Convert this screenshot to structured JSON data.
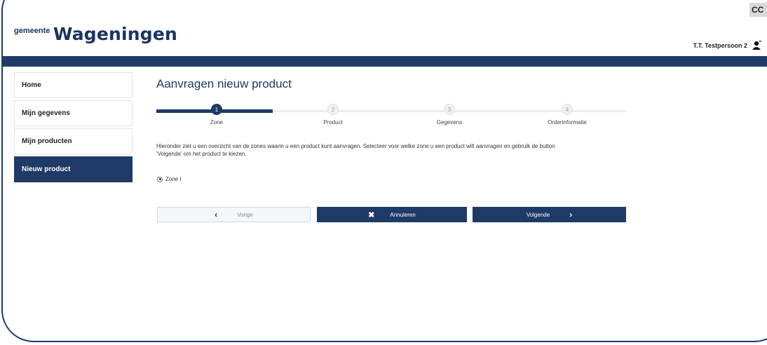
{
  "header": {
    "logo_prefix": "gemeente",
    "logo_name": "Wageningen",
    "user_name": "T.T. Testpersoon 2",
    "corner_label": "CC"
  },
  "sidebar": {
    "items": [
      {
        "label": "Home"
      },
      {
        "label": "Mijn gegevens"
      },
      {
        "label": "Mijn producten"
      },
      {
        "label": "Nieuw product"
      }
    ]
  },
  "main": {
    "title": "Aanvragen nieuw product",
    "steps": [
      {
        "number": "1",
        "label": "Zone"
      },
      {
        "number": "2",
        "label": "Product"
      },
      {
        "number": "3",
        "label": "Gegevens"
      },
      {
        "number": "4",
        "label": "Orderinformatie"
      }
    ],
    "intro_line1": "Hieronder ziet u een overzicht van de zones waarin u een product kunt aanvragen. Selecteer voor welke zone u een product wilt aanvragen en gebruik de button",
    "intro_line2": "'Volgende' om het product te kiezen.",
    "radio_label": "Zone I",
    "buttons": {
      "prev": "Vorige",
      "cancel": "Annuleren",
      "next": "Volgende"
    }
  },
  "colors": {
    "brand": "#1e3a66"
  },
  "icons": {
    "user": "user-icon",
    "prev": "chevron-left-icon",
    "cancel": "close-icon",
    "next": "chevron-right-icon"
  }
}
